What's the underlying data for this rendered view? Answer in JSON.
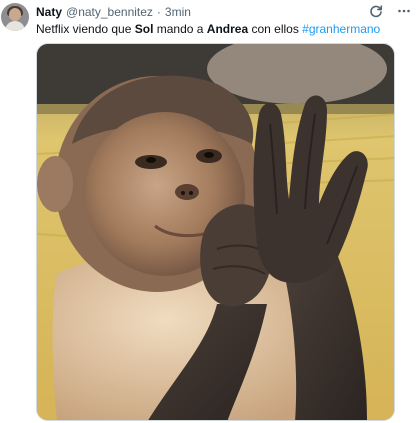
{
  "author": {
    "display_name": "Naty",
    "handle": "@naty_bennitez",
    "separator": "·",
    "time": "3min"
  },
  "tweet": {
    "parts": [
      {
        "text": "Netflix viendo que ",
        "style": "normal"
      },
      {
        "text": "Sol",
        "style": "bold"
      },
      {
        "text": " mando a ",
        "style": "normal"
      },
      {
        "text": "Andrea",
        "style": "bold"
      },
      {
        "text": " con ellos ",
        "style": "normal"
      },
      {
        "text": "#granhermano",
        "style": "hashtag"
      }
    ]
  },
  "icons": {
    "avatar": "profile-avatar",
    "refresh": "refresh-icon",
    "more": "more-icon"
  },
  "colors": {
    "hashtag": "#1d9bf0",
    "secondary_text": "#536471",
    "primary_text": "#0f1419",
    "media_border": "#cfd9de"
  }
}
